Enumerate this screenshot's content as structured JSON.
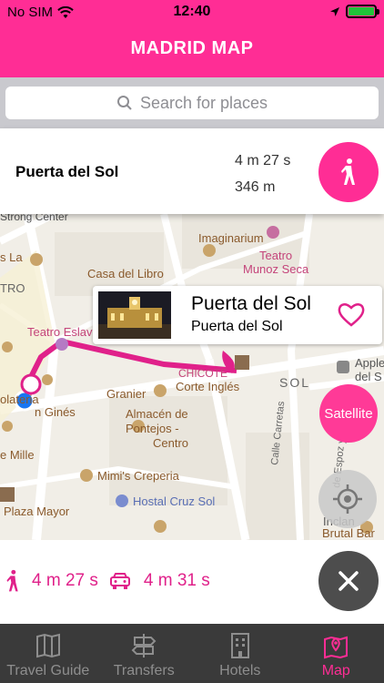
{
  "status": {
    "carrier": "No SIM",
    "time": "12:40"
  },
  "header": {
    "title": "MADRID MAP"
  },
  "search": {
    "placeholder": "Search for places"
  },
  "destination": {
    "name": "Puerta del Sol",
    "time": "4 m 27 s",
    "distance": "346 m"
  },
  "map": {
    "labels": {
      "imaginarium": "Imaginarium",
      "teatro": "Teatro",
      "munoz_seca": "Munoz Seca",
      "casa_del_libro": "Casa del Libro",
      "teatro_eslava": "Teatro Eslav",
      "chicote": "CHICOTE",
      "corte_ingles": "Corte Inglés",
      "granier": "Granier",
      "almacen": "Almacén de",
      "pontejos": "Pontejos -",
      "centro": "Centro",
      "mimis": "Mimi's Creperia",
      "hostal": "Hostal Cruz Sol",
      "plaza_mayor": "Plaza Mayor",
      "apple": "Apple",
      "apple_2": "del S",
      "sol": "SOL",
      "calle_carretas": "Calle Carretas",
      "espoz": "de Espoz y Mina",
      "inclan": "Inclan",
      "brutal": "Brutal Bar",
      "olateria": "olateria",
      "gines": "n Ginés",
      "mille": "e Mille",
      "la": "s La",
      "tro": "TRO",
      "center": "Strong Center"
    },
    "popup": {
      "title": "Puerta del Sol",
      "subtitle": "Puerta del Sol"
    },
    "satellite_label": "Satellite"
  },
  "summary": {
    "walk_time": "4 m 27 s",
    "car_time": "4 m 31 s"
  },
  "tabs": [
    {
      "label": "Travel Guide",
      "icon": "map-book-icon"
    },
    {
      "label": "Transfers",
      "icon": "signpost-icon"
    },
    {
      "label": "Hotels",
      "icon": "building-icon"
    },
    {
      "label": "Map",
      "icon": "map-pin-icon"
    }
  ],
  "colors": {
    "accent": "#ff2d95",
    "tabbar": "#3a3a3a"
  }
}
